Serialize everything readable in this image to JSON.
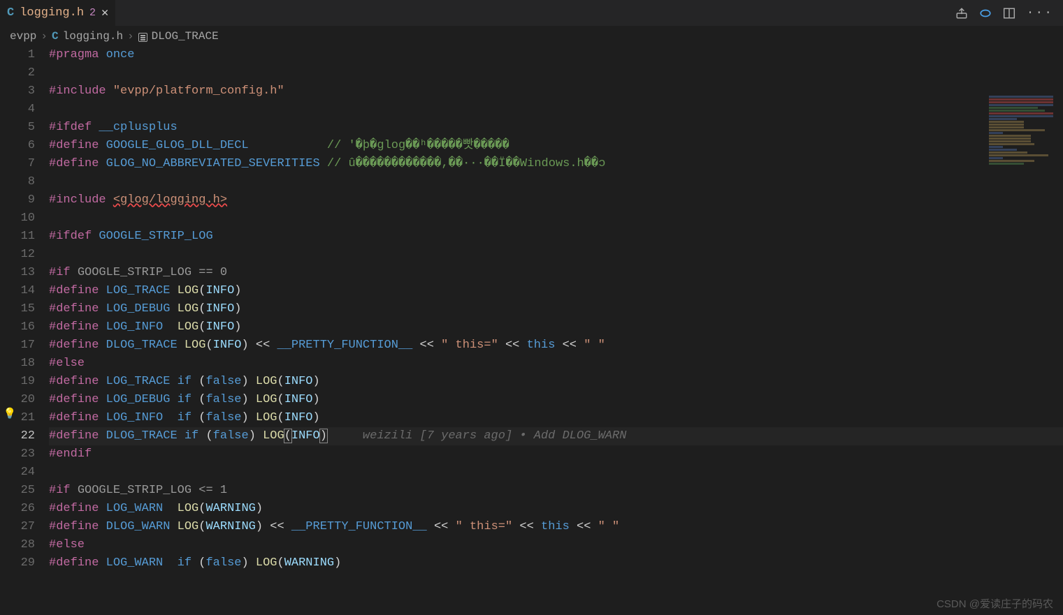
{
  "tab": {
    "lang_icon": "C",
    "filename": "logging.h",
    "modified_count": "2",
    "close_icon": "✕"
  },
  "actions": {
    "run_icon": "▷",
    "split_icon": "◫",
    "more_icon": "···"
  },
  "breadcrumb": {
    "folder": "evpp",
    "sep": "›",
    "lang_icon": "C",
    "file": "logging.h",
    "symbol": "DLOG_TRACE"
  },
  "git_lens": {
    "author": "weizili",
    "age": "[7 years ago]",
    "bullet": "•",
    "message": "Add DLOG_WARN"
  },
  "watermark": "CSDN @爱读庄子的码农",
  "code": {
    "lines": [
      {
        "n": 1,
        "seg": [
          [
            "k",
            "#pragma"
          ],
          [
            "n",
            " "
          ],
          [
            "m",
            "once"
          ]
        ]
      },
      {
        "n": 2,
        "seg": []
      },
      {
        "n": 3,
        "seg": [
          [
            "k",
            "#include"
          ],
          [
            "n",
            " "
          ],
          [
            "s",
            "\"evpp/platform_config.h\""
          ]
        ]
      },
      {
        "n": 4,
        "seg": []
      },
      {
        "n": 5,
        "seg": [
          [
            "k",
            "#ifdef"
          ],
          [
            "n",
            " "
          ],
          [
            "m",
            "__cplusplus"
          ]
        ]
      },
      {
        "n": 6,
        "seg": [
          [
            "k",
            "#define"
          ],
          [
            "n",
            " "
          ],
          [
            "m",
            "GOOGLE_GLOG_DLL_DECL"
          ],
          [
            "n",
            "           "
          ],
          [
            "c",
            "// '�þ�glog��ʰ�����빳�����"
          ]
        ]
      },
      {
        "n": 7,
        "seg": [
          [
            "k",
            "#define"
          ],
          [
            "n",
            " "
          ],
          [
            "m",
            "GLOG_NO_ABBREVIATED_SEVERITIES"
          ],
          [
            "n",
            " "
          ],
          [
            "c",
            "// û������������,��···��Ï��Windows.h��ɔ"
          ]
        ]
      },
      {
        "n": 8,
        "seg": []
      },
      {
        "n": 9,
        "seg": [
          [
            "k",
            "#include"
          ],
          [
            "n",
            " "
          ],
          [
            "su",
            "<glog/logging.h>"
          ]
        ]
      },
      {
        "n": 10,
        "seg": []
      },
      {
        "n": 11,
        "seg": [
          [
            "k",
            "#ifdef"
          ],
          [
            "n",
            " "
          ],
          [
            "m",
            "GOOGLE_STRIP_LOG"
          ]
        ]
      },
      {
        "n": 12,
        "seg": []
      },
      {
        "n": 13,
        "seg": [
          [
            "k",
            "#if"
          ],
          [
            "n",
            " "
          ],
          [
            "gray",
            "GOOGLE_STRIP_LOG == 0"
          ]
        ]
      },
      {
        "n": 14,
        "seg": [
          [
            "k",
            "#define"
          ],
          [
            "n",
            " "
          ],
          [
            "m",
            "LOG_TRACE"
          ],
          [
            "n",
            " "
          ],
          [
            "f",
            "LOG"
          ],
          [
            "n",
            "("
          ],
          [
            "i",
            "INFO"
          ],
          [
            "n",
            ")"
          ]
        ]
      },
      {
        "n": 15,
        "seg": [
          [
            "k",
            "#define"
          ],
          [
            "n",
            " "
          ],
          [
            "m",
            "LOG_DEBUG"
          ],
          [
            "n",
            " "
          ],
          [
            "f",
            "LOG"
          ],
          [
            "n",
            "("
          ],
          [
            "i",
            "INFO"
          ],
          [
            "n",
            ")"
          ]
        ]
      },
      {
        "n": 16,
        "seg": [
          [
            "k",
            "#define"
          ],
          [
            "n",
            " "
          ],
          [
            "m",
            "LOG_INFO"
          ],
          [
            "n",
            "  "
          ],
          [
            "f",
            "LOG"
          ],
          [
            "n",
            "("
          ],
          [
            "i",
            "INFO"
          ],
          [
            "n",
            ")"
          ]
        ]
      },
      {
        "n": 17,
        "seg": [
          [
            "k",
            "#define"
          ],
          [
            "n",
            " "
          ],
          [
            "m",
            "DLOG_TRACE"
          ],
          [
            "n",
            " "
          ],
          [
            "f",
            "LOG"
          ],
          [
            "n",
            "("
          ],
          [
            "i",
            "INFO"
          ],
          [
            "n",
            ") << "
          ],
          [
            "m",
            "__PRETTY_FUNCTION__"
          ],
          [
            "n",
            " << "
          ],
          [
            "s",
            "\" this=\""
          ],
          [
            "n",
            " << "
          ],
          [
            "m",
            "this"
          ],
          [
            "n",
            " << "
          ],
          [
            "s",
            "\" \""
          ]
        ]
      },
      {
        "n": 18,
        "seg": [
          [
            "k",
            "#else"
          ]
        ]
      },
      {
        "n": 19,
        "seg": [
          [
            "k",
            "#define"
          ],
          [
            "n",
            " "
          ],
          [
            "m",
            "LOG_TRACE"
          ],
          [
            "n",
            " "
          ],
          [
            "m",
            "if"
          ],
          [
            "n",
            " ("
          ],
          [
            "m",
            "false"
          ],
          [
            "n",
            ") "
          ],
          [
            "f",
            "LOG"
          ],
          [
            "n",
            "("
          ],
          [
            "i",
            "INFO"
          ],
          [
            "n",
            ")"
          ]
        ]
      },
      {
        "n": 20,
        "seg": [
          [
            "k",
            "#define"
          ],
          [
            "n",
            " "
          ],
          [
            "m",
            "LOG_DEBUG"
          ],
          [
            "n",
            " "
          ],
          [
            "m",
            "if"
          ],
          [
            "n",
            " ("
          ],
          [
            "m",
            "false"
          ],
          [
            "n",
            ") "
          ],
          [
            "f",
            "LOG"
          ],
          [
            "n",
            "("
          ],
          [
            "i",
            "INFO"
          ],
          [
            "n",
            ")"
          ]
        ]
      },
      {
        "n": 21,
        "seg": [
          [
            "k",
            "#define"
          ],
          [
            "n",
            " "
          ],
          [
            "m",
            "LOG_INFO"
          ],
          [
            "n",
            "  "
          ],
          [
            "m",
            "if"
          ],
          [
            "n",
            " ("
          ],
          [
            "m",
            "false"
          ],
          [
            "n",
            ") "
          ],
          [
            "f",
            "LOG"
          ],
          [
            "n",
            "("
          ],
          [
            "i",
            "INFO"
          ],
          [
            "n",
            ")"
          ]
        ],
        "bulb": true
      },
      {
        "n": 22,
        "seg": [
          [
            "k",
            "#define"
          ],
          [
            "n",
            " "
          ],
          [
            "m",
            "DLOG_TRACE"
          ],
          [
            "n",
            " "
          ],
          [
            "m",
            "if"
          ],
          [
            "n",
            " ("
          ],
          [
            "m",
            "false"
          ],
          [
            "n",
            ") "
          ],
          [
            "f",
            "LOG"
          ],
          [
            "br",
            "("
          ],
          [
            "i",
            "INFO"
          ],
          [
            "br",
            ")"
          ]
        ],
        "cursor": true,
        "blame": true
      },
      {
        "n": 23,
        "seg": [
          [
            "k",
            "#endif"
          ]
        ]
      },
      {
        "n": 24,
        "seg": []
      },
      {
        "n": 25,
        "seg": [
          [
            "k",
            "#if"
          ],
          [
            "n",
            " "
          ],
          [
            "gray",
            "GOOGLE_STRIP_LOG <= 1"
          ]
        ]
      },
      {
        "n": 26,
        "seg": [
          [
            "k",
            "#define"
          ],
          [
            "n",
            " "
          ],
          [
            "m",
            "LOG_WARN"
          ],
          [
            "n",
            "  "
          ],
          [
            "f",
            "LOG"
          ],
          [
            "n",
            "("
          ],
          [
            "i",
            "WARNING"
          ],
          [
            "n",
            ")"
          ]
        ]
      },
      {
        "n": 27,
        "seg": [
          [
            "k",
            "#define"
          ],
          [
            "n",
            " "
          ],
          [
            "m",
            "DLOG_WARN"
          ],
          [
            "n",
            " "
          ],
          [
            "f",
            "LOG"
          ],
          [
            "n",
            "("
          ],
          [
            "i",
            "WARNING"
          ],
          [
            "n",
            ") << "
          ],
          [
            "m",
            "__PRETTY_FUNCTION__"
          ],
          [
            "n",
            " << "
          ],
          [
            "s",
            "\" this=\""
          ],
          [
            "n",
            " << "
          ],
          [
            "m",
            "this"
          ],
          [
            "n",
            " << "
          ],
          [
            "s",
            "\" \""
          ]
        ]
      },
      {
        "n": 28,
        "seg": [
          [
            "k",
            "#else"
          ]
        ]
      },
      {
        "n": 29,
        "seg": [
          [
            "k",
            "#define"
          ],
          [
            "n",
            " "
          ],
          [
            "m",
            "LOG_WARN"
          ],
          [
            "n",
            "  "
          ],
          [
            "m",
            "if"
          ],
          [
            "n",
            " ("
          ],
          [
            "m",
            "false"
          ],
          [
            "n",
            ") "
          ],
          [
            "f",
            "LOG"
          ],
          [
            "n",
            "("
          ],
          [
            "i",
            "WARNING"
          ],
          [
            "n",
            ")"
          ]
        ]
      }
    ]
  }
}
